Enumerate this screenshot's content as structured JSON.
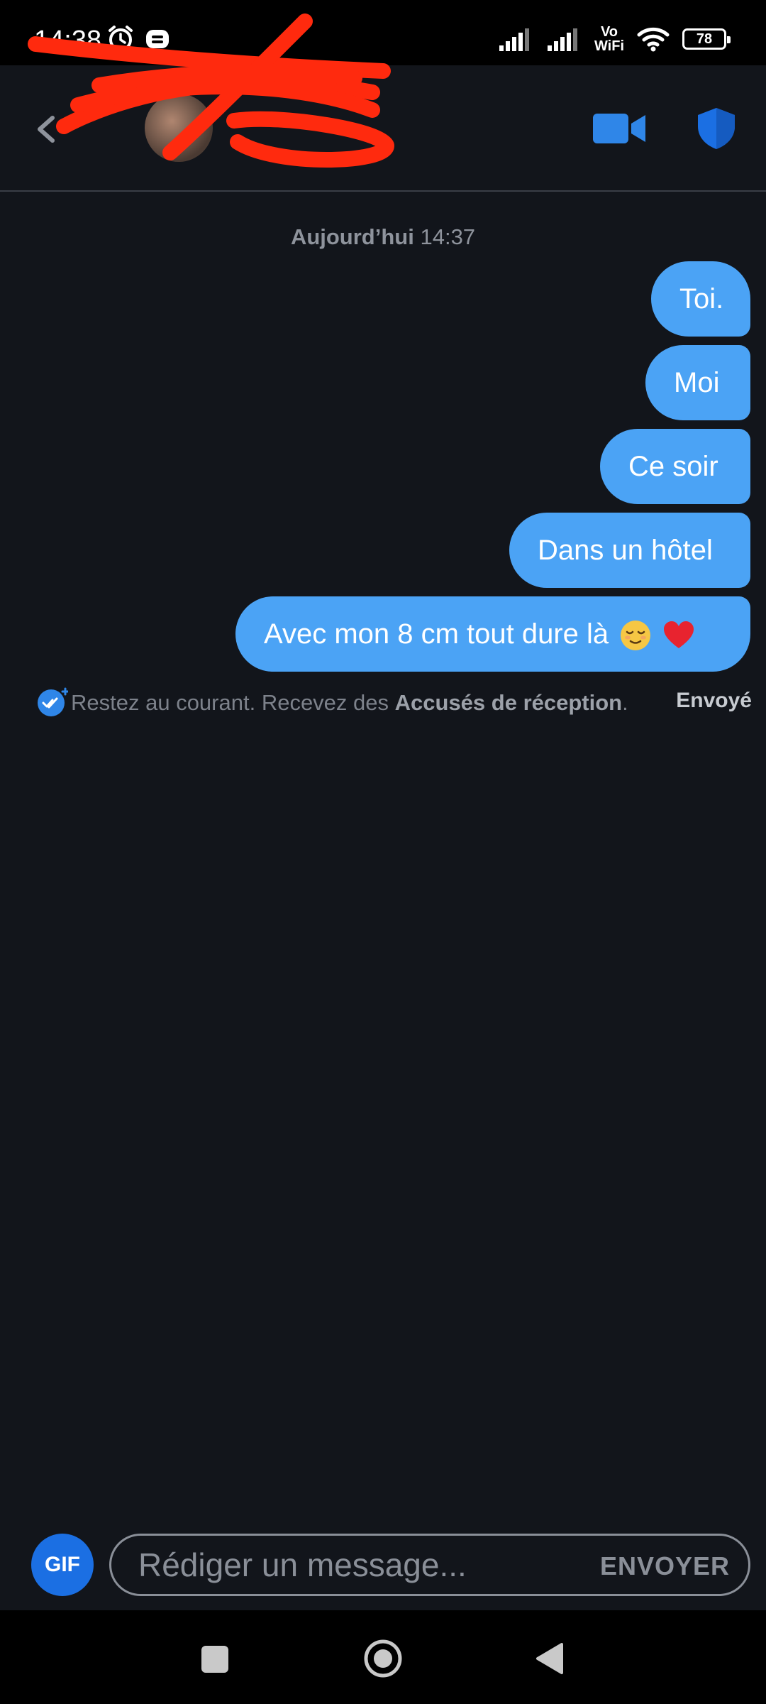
{
  "status_bar": {
    "time": "14:38",
    "vowifi": [
      "Vo",
      "WiFi"
    ],
    "battery": "78",
    "icons": [
      "alarm-icon",
      "app-notification-icon",
      "signal-icon",
      "wifi-icon",
      "battery-icon"
    ]
  },
  "header": {
    "contact_name": "",
    "icons": [
      "back-arrow-icon",
      "video-call-icon",
      "shield-icon"
    ]
  },
  "conversation": {
    "date_day": "Aujourd’hui",
    "date_time": "14:37",
    "messages": [
      {
        "text": "Toi."
      },
      {
        "text": "Moi"
      },
      {
        "text": "Ce soir"
      },
      {
        "text": "Dans un hôtel"
      },
      {
        "text": "Avec mon 8 cm tout dure là",
        "emojis": [
          "relieved-face",
          "red-heart"
        ]
      }
    ],
    "receipt_prefix": "Restez au courant. Recevez des ",
    "receipt_link": "Accusés de réception",
    "receipt_suffix": ".",
    "status": "Envoyé"
  },
  "composer": {
    "gif_label": "GIF",
    "placeholder": "Rédiger un message...",
    "send_label": "ENVOYER"
  },
  "colors": {
    "background": "#12151b",
    "bubble": "#4ba3f5",
    "accent": "#1b6fe3",
    "redaction": "#ff2a0e"
  }
}
